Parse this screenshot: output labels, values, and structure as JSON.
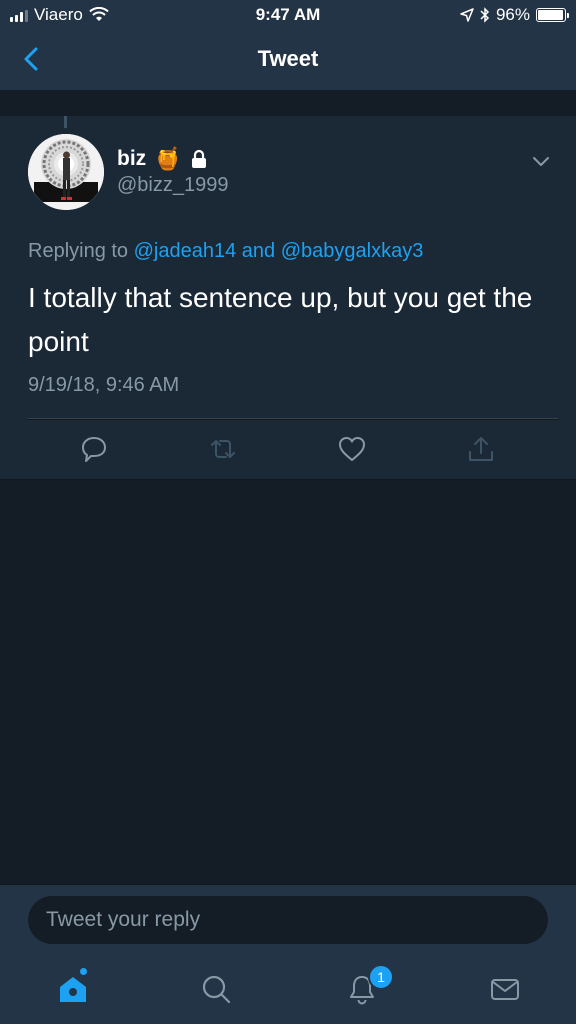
{
  "status_bar": {
    "carrier": "Viaero",
    "time": "9:47 AM",
    "battery_percent": "96%",
    "battery_level": 0.96
  },
  "nav": {
    "title": "Tweet"
  },
  "tweet": {
    "display_name": "biz",
    "emoji": "🍯",
    "handle": "@bizz_1999",
    "replying_prefix": "Replying to",
    "reply_user_1": "@jadeah14",
    "reply_and": "and",
    "reply_user_2": "@babygalxkay3",
    "text": "I totally that sentence up, but you get the point",
    "timestamp": "9/19/18, 9:46 AM"
  },
  "reply": {
    "placeholder": "Tweet your reply"
  },
  "tabs": {
    "notifications_badge": "1"
  },
  "colors": {
    "accent": "#1da1f2",
    "background": "#141d26",
    "card": "#1b2836",
    "bar": "#243447",
    "secondary_text": "#8899a6"
  },
  "icons": [
    "back-chevron-icon",
    "lock-icon",
    "chevron-down-icon",
    "reply-icon",
    "retweet-icon",
    "like-icon",
    "share-icon",
    "home-icon",
    "search-icon",
    "notifications-icon",
    "messages-icon",
    "wifi-icon",
    "location-icon",
    "bluetooth-icon",
    "battery-icon",
    "signal-icon"
  ]
}
